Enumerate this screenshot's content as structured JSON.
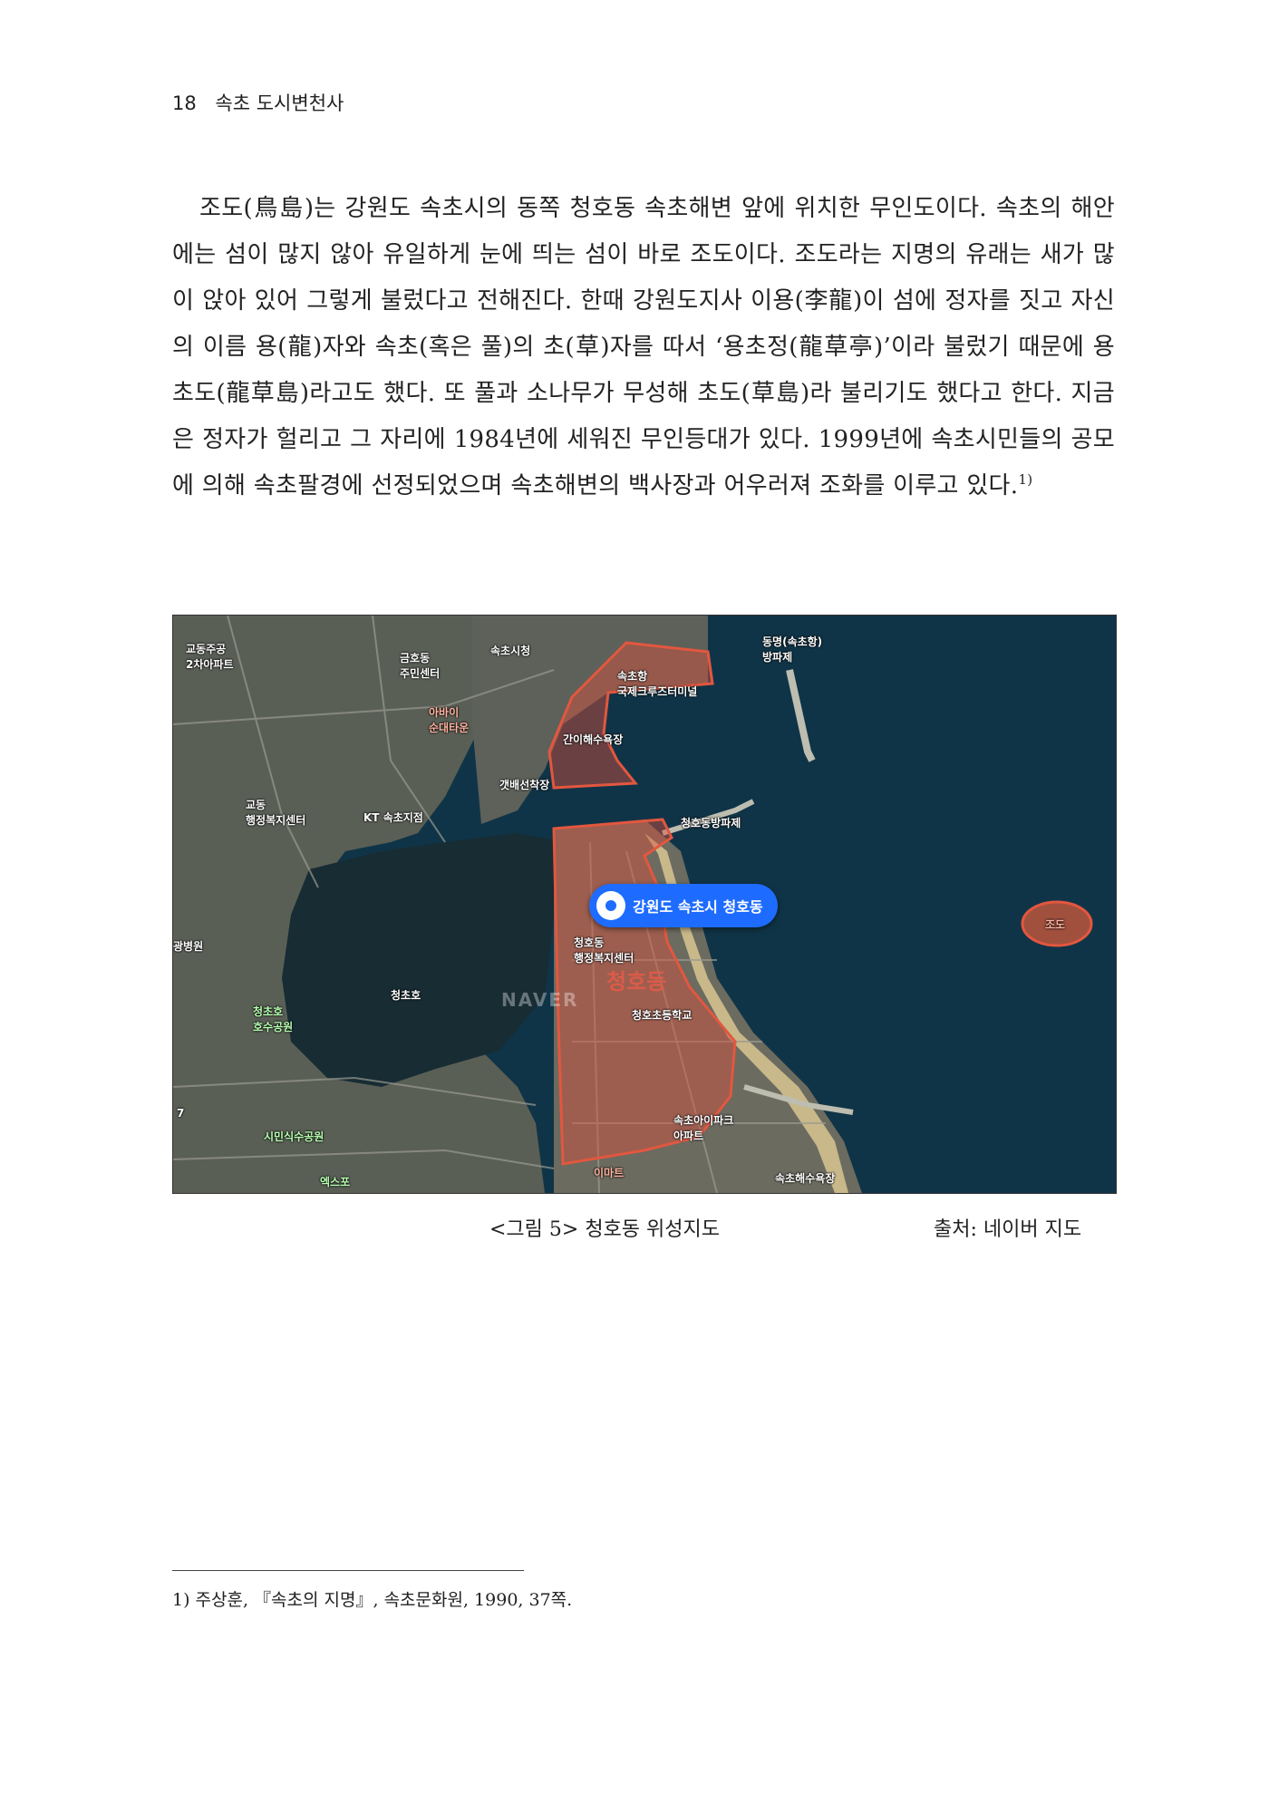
{
  "header": {
    "page_number": "18",
    "running_title": "속초 도시변천사"
  },
  "body": {
    "paragraph": "조도(鳥島)는 강원도 속초시의 동쪽 청호동 속초해변 앞에 위치한 무인도이다. 속초의 해안에는 섬이 많지 않아 유일하게 눈에 띄는 섬이 바로 조도이다. 조도라는 지명의 유래는 새가 많이 앉아 있어 그렇게 불렀다고 전해진다. 한때 강원도지사 이용(李龍)이 섬에 정자를 짓고 자신의 이름 용(龍)자와 속초(혹은 풀)의 초(草)자를 따서 ‘용초정(龍草亭)’이라 불렀기 때문에 용초도(龍草島)라고도 했다. 또 풀과 소나무가 무성해 초도(草島)라 불리기도 했다고 한다. 지금은 정자가 헐리고 그 자리에 1984년에 세워진 무인등대가 있다. 1999년에 속초시민들의 공모에 의해 속초팔경에 선정되었으며 속초해변의 백사장과 어우러져 조화를 이루고 있다.",
    "footnote_ref": "1)"
  },
  "map": {
    "pin_label": "강원도 속초시 청호동",
    "labels": {
      "gyodong_apt": "교동주공\n2차아파트",
      "geumhodong": "금호동\n주민센터",
      "sokcho_cityhall": "속초시청",
      "dongmyeong": "동명(속초항)\n방파제",
      "sokcho_port": "속초항\n국제크루즈터미널",
      "abai": "아바이\n순대타운",
      "ganie": "간이해수욕장",
      "gaetbae": "갯배선착장",
      "gyodong_center": "교동\n행정복지센터",
      "kt": "KT 속초지점",
      "breakwater": "청호동방파제",
      "hospital": "광병원",
      "cheongho_center": "청호동\n행정복지센터",
      "cheongho_big": "청호동",
      "cheongcho_lake": "청초호",
      "lake_park": "청초호\n호수공원",
      "cheongho_school": "청호초등학교",
      "apartment": "속초아이파크\n아파트",
      "citizen_park": "시민식수공원",
      "expo": "엑스포",
      "emart": "이마트",
      "beach": "속초해수욕장",
      "jodo": "조도",
      "naver": "NAVER",
      "route7": "7"
    }
  },
  "caption": {
    "title": "<그림 5> 청호동 위성지도",
    "source": "출처: 네이버 지도"
  },
  "footnote": {
    "text": "1) 주상훈, 『속초의 지명』, 속초문화원, 1990, 37쪽."
  }
}
